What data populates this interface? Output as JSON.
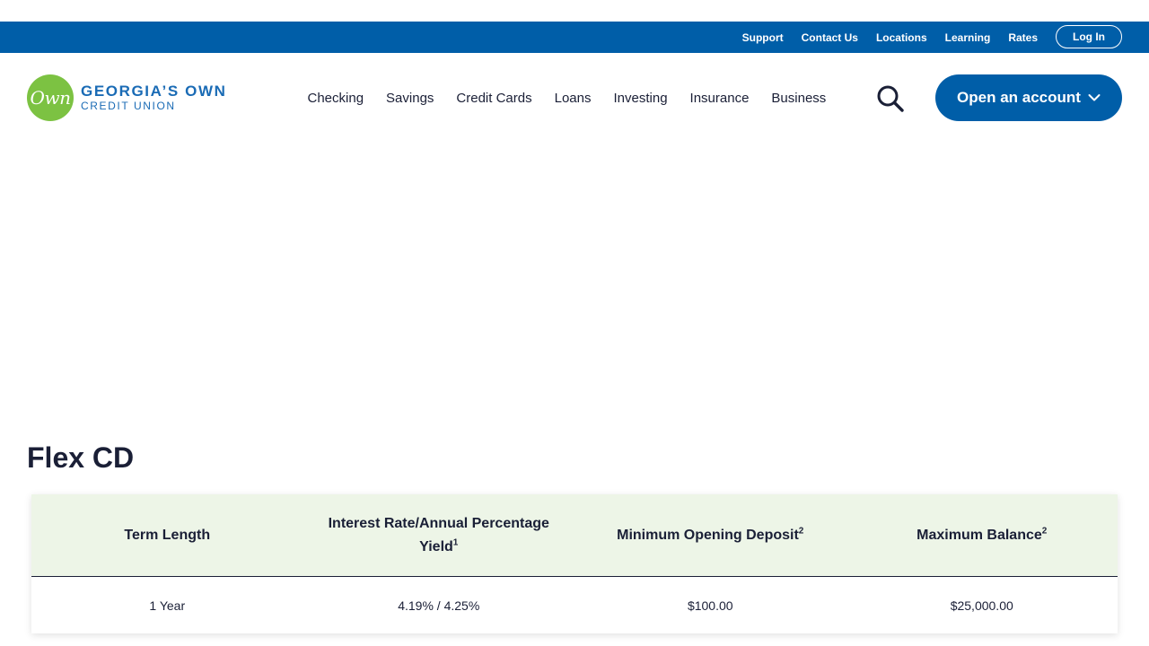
{
  "utility_nav": {
    "links": [
      "Support",
      "Contact Us",
      "Locations",
      "Learning",
      "Rates"
    ],
    "login_label": "Log In"
  },
  "logo": {
    "badge": "Own",
    "line1": "GEORGIA’S OWN",
    "line2": "CREDIT UNION"
  },
  "main_nav": {
    "items": [
      "Checking",
      "Savings",
      "Credit Cards",
      "Loans",
      "Investing",
      "Insurance",
      "Business"
    ],
    "search_icon": "search-icon",
    "cta_label": "Open an account",
    "cta_icon": "chevron-down-icon"
  },
  "colors": {
    "brand_blue": "#005ea8",
    "brand_green": "#7cc242",
    "table_header_bg": "#edf5e7",
    "text_dark": "#1a1f36"
  },
  "product": {
    "title": "Flex CD",
    "table": {
      "headers": [
        {
          "label": "Term Length",
          "sup": ""
        },
        {
          "label": "Interest Rate/Annual Percentage Yield",
          "sup": "1"
        },
        {
          "label": "Minimum Opening Deposit",
          "sup": "2"
        },
        {
          "label": "Maximum Balance",
          "sup": "2"
        }
      ],
      "rows": [
        [
          "1 Year",
          "4.19% / 4.25%",
          "$100.00",
          "$25,000.00"
        ]
      ]
    }
  }
}
